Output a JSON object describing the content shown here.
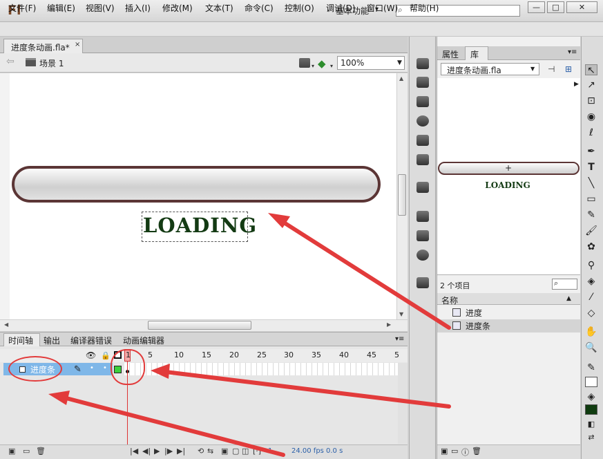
{
  "app": {
    "logo": "Fl",
    "workspace": "基本功能",
    "workspace_arrow": "▾",
    "search_icon": "⌕"
  },
  "window_buttons": {
    "minimize": "—",
    "maximize": "□",
    "close": "✕"
  },
  "menu": [
    "文件(F)",
    "编辑(E)",
    "视图(V)",
    "插入(I)",
    "修改(M)",
    "文本(T)",
    "命令(C)",
    "控制(O)",
    "调试(D)",
    "窗口(W)",
    "帮助(H)"
  ],
  "document": {
    "tab_label": "进度条动画.fla*",
    "close": "×",
    "scene": "场景 1",
    "zoom": "100%"
  },
  "stage": {
    "loading_text": "LOADING"
  },
  "timeline": {
    "tabs": [
      "时间轴",
      "输出",
      "编译器错误",
      "动画编辑器"
    ],
    "frame_numbers": [
      "1",
      "5",
      "10",
      "15",
      "20",
      "25",
      "30",
      "35",
      "40",
      "45",
      "5"
    ],
    "layer_name": "进度条",
    "current_frame": "1",
    "fps": "24.00 fps",
    "time": "0.0 s"
  },
  "library": {
    "tab_properties": "属性",
    "tab_library": "库",
    "document": "进度条动画.fla",
    "preview_text": "LOADING",
    "item_count": "2 个项目",
    "column_name": "名称",
    "items": [
      "进度",
      "进度条"
    ]
  },
  "colors": {
    "annotation": "#e23b3b",
    "stage_text": "#133a13",
    "bar_border": "#5b3535",
    "fill": "#0f3b0f",
    "layer_highlight": "#7fb7e8"
  }
}
